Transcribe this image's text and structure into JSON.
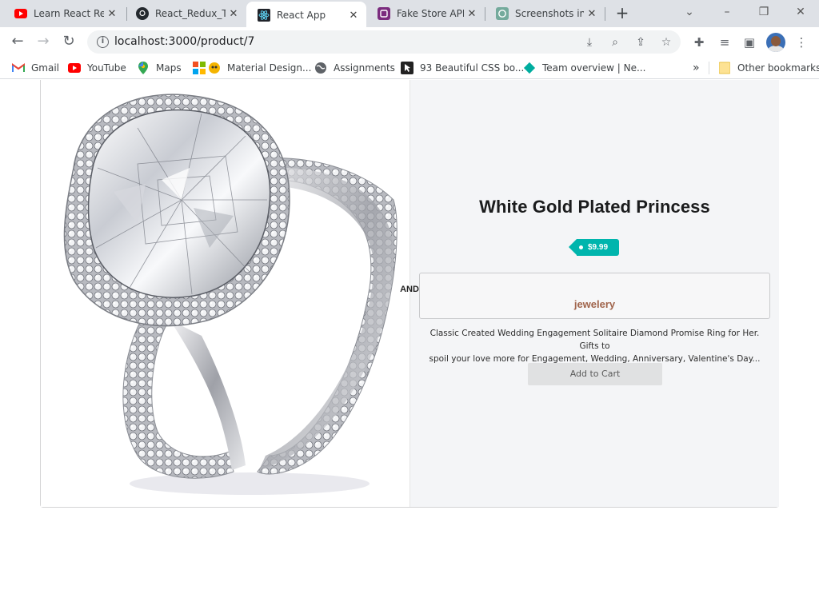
{
  "browser": {
    "tabs": [
      {
        "label": "Learn React Red",
        "icon": "youtube-icon",
        "active": false
      },
      {
        "label": "React_Redux_Tu",
        "icon": "github-icon",
        "active": false
      },
      {
        "label": "React App",
        "icon": "react-icon",
        "active": true
      },
      {
        "label": "Fake Store API",
        "icon": "fakestore-icon",
        "active": false
      },
      {
        "label": "Screenshots in V",
        "icon": "openai-icon",
        "active": false
      }
    ],
    "url": "localhost:3000/product/7",
    "bookmarks": [
      {
        "label": "Gmail",
        "icon": "gmail-icon"
      },
      {
        "label": "YouTube",
        "icon": "youtube-icon"
      },
      {
        "label": "Maps",
        "icon": "maps-icon"
      },
      {
        "label": "Material Design...",
        "icon": "material-design-icon"
      },
      {
        "label": "Assignments",
        "icon": "globe-icon"
      },
      {
        "label": "93 Beautiful CSS bo...",
        "icon": "cursor-icon"
      },
      {
        "label": "Team overview | Ne...",
        "icon": "diamond-icon"
      }
    ],
    "overflow_label": "»",
    "other_bookmarks": "Other bookmarks"
  },
  "product": {
    "title": "White Gold Plated Princess",
    "price": "$9.99",
    "separator": "AND",
    "category": "jewelery",
    "description_line1": "Classic Created Wedding Engagement Solitaire Diamond Promise Ring for Her. Gifts to",
    "description_line2": "spoil your love more for Engagement, Wedding, Anniversary, Valentine's Day...",
    "add_to_cart": "Add to Cart",
    "image_subject": "diamond-ring-image"
  },
  "colors": {
    "price_tag": "#00b5ad",
    "category": "#a0644b",
    "info_bg": "#f4f5f7"
  }
}
